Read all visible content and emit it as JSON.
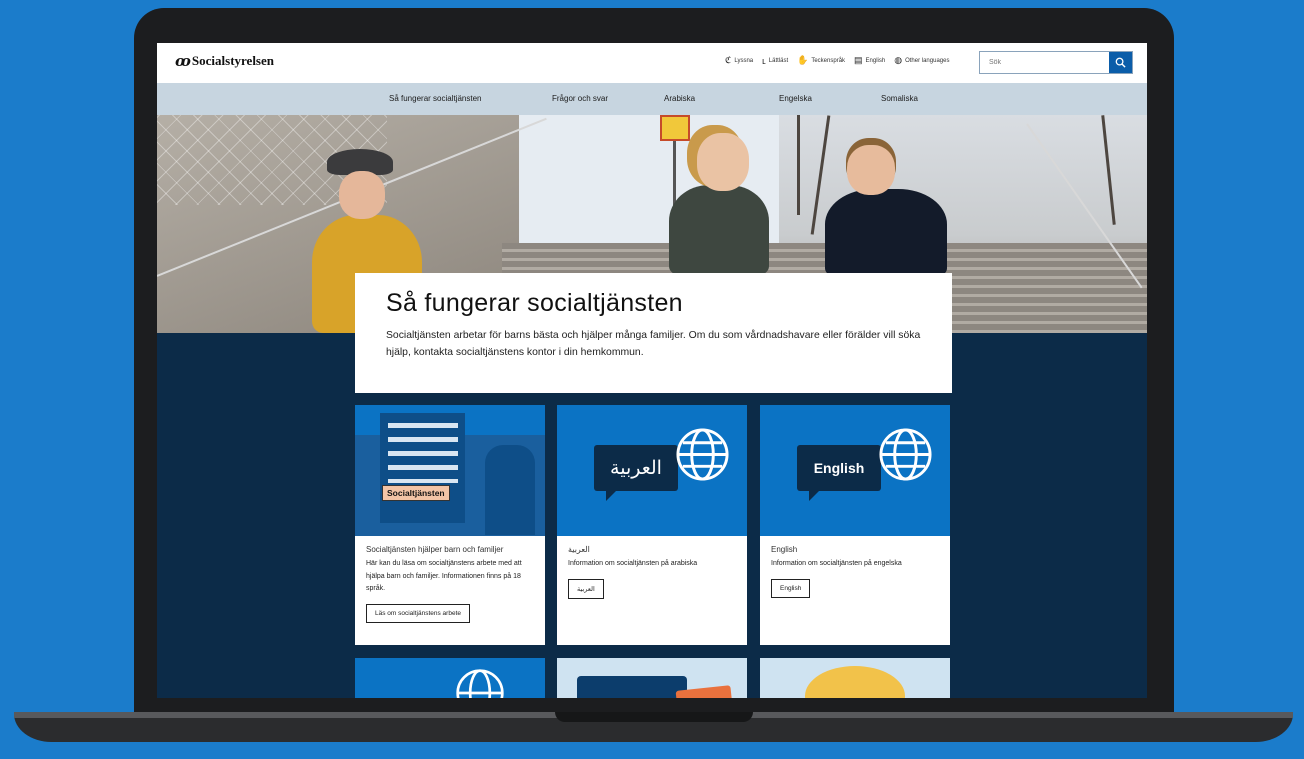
{
  "header": {
    "logo_text": "Socialstyrelsen",
    "tools": [
      {
        "label": "Lyssna",
        "icon": "ear-icon"
      },
      {
        "label": "Lättläst",
        "icon": "easy-read-icon"
      },
      {
        "label": "Teckenspråk",
        "icon": "sign-language-icon"
      },
      {
        "label": "English",
        "icon": "speech-bubble-icon"
      },
      {
        "label": "Other languages",
        "icon": "globe-icon"
      }
    ],
    "search_placeholder": "Sök"
  },
  "nav": {
    "items": [
      "Så fungerar socialtjänsten",
      "Frågor och svar",
      "Arabiska",
      "Engelska",
      "Somaliska"
    ]
  },
  "intro": {
    "title": "Så fungerar socialtjänsten",
    "text": "Socialtjänsten arbetar för barns bästa och hjälper många familjer. Om du som vårdnadshavare eller förälder vill söka hjälp, kontakta socialtjänstens kontor i din hemkommun."
  },
  "cards": [
    {
      "image_label": "Socialtjänsten",
      "title": "Socialtjänsten hjälper barn och familjer",
      "text": "Här kan du läsa om socialtjänstens arbete med att hjälpa barn och familjer. Informationen finns på 18 språk.",
      "button": "Läs om socialtjänstens arbete"
    },
    {
      "image_label": "العربية",
      "title": "العربية",
      "text": "Information om socialtjänsten på arabiska",
      "button": "العربية"
    },
    {
      "image_label": "English",
      "title": "English",
      "text": "Information om socialtjänsten på engelska",
      "button": "English"
    }
  ],
  "colors": {
    "background": "#1b7ccb",
    "page_dark": "#0c2b48",
    "nav_bg": "#c7d5e0",
    "card_image_blue": "#0b73c4",
    "search_button": "#0b5da9"
  }
}
